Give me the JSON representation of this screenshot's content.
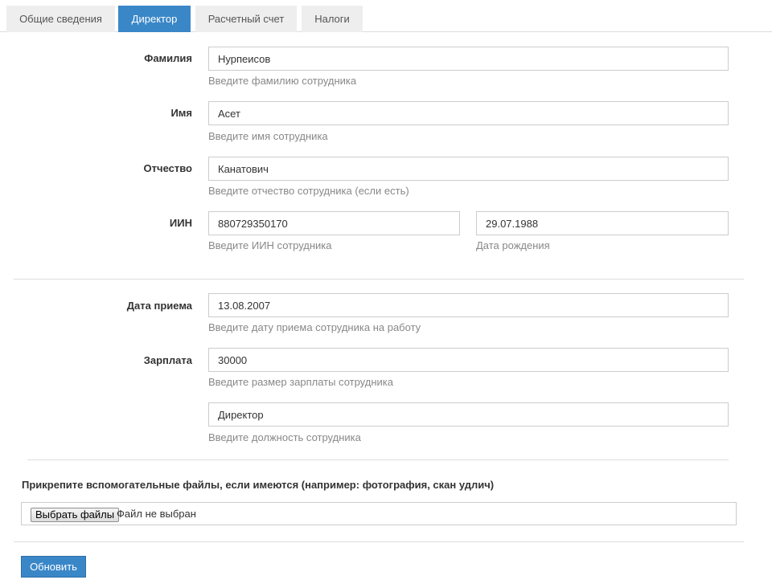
{
  "tabs": [
    {
      "label": "Общие сведения",
      "active": false
    },
    {
      "label": "Директор",
      "active": true
    },
    {
      "label": "Расчетный счет",
      "active": false
    },
    {
      "label": "Налоги",
      "active": false
    }
  ],
  "form": {
    "surname": {
      "label": "Фамилия",
      "value": "Нурпеисов",
      "help": "Введите фамилию сотрудника"
    },
    "name": {
      "label": "Имя",
      "value": "Асет",
      "help": "Введите имя сотрудника"
    },
    "patronymic": {
      "label": "Отчество",
      "value": "Канатович",
      "help": "Введите отчество сотрудника (если есть)"
    },
    "iin": {
      "label": "ИИН",
      "value": "880729350170",
      "help": "Введите ИИН сотрудника"
    },
    "birth_date": {
      "value": "29.07.1988",
      "help": "Дата рождения"
    },
    "hire_date": {
      "label": "Дата приема",
      "value": "13.08.2007",
      "help": "Введите дату приема сотрудника на работу"
    },
    "salary": {
      "label": "Зарплата",
      "value": "30000",
      "help": "Введите размер зарплаты сотрудника"
    },
    "position": {
      "value": "Директор",
      "help": "Введите должность сотрудника"
    }
  },
  "attachments": {
    "label": "Прикрепите вспомогательные файлы, если имеются (например: фотография, скан удлич)",
    "button_label": "Выбрать файлы",
    "status": "Файл не выбран"
  },
  "submit_label": "Обновить",
  "colors": {
    "accent": "#3a87c8",
    "tab_inactive": "#eeeeee",
    "border": "#cccccc",
    "help_text": "#888888"
  }
}
